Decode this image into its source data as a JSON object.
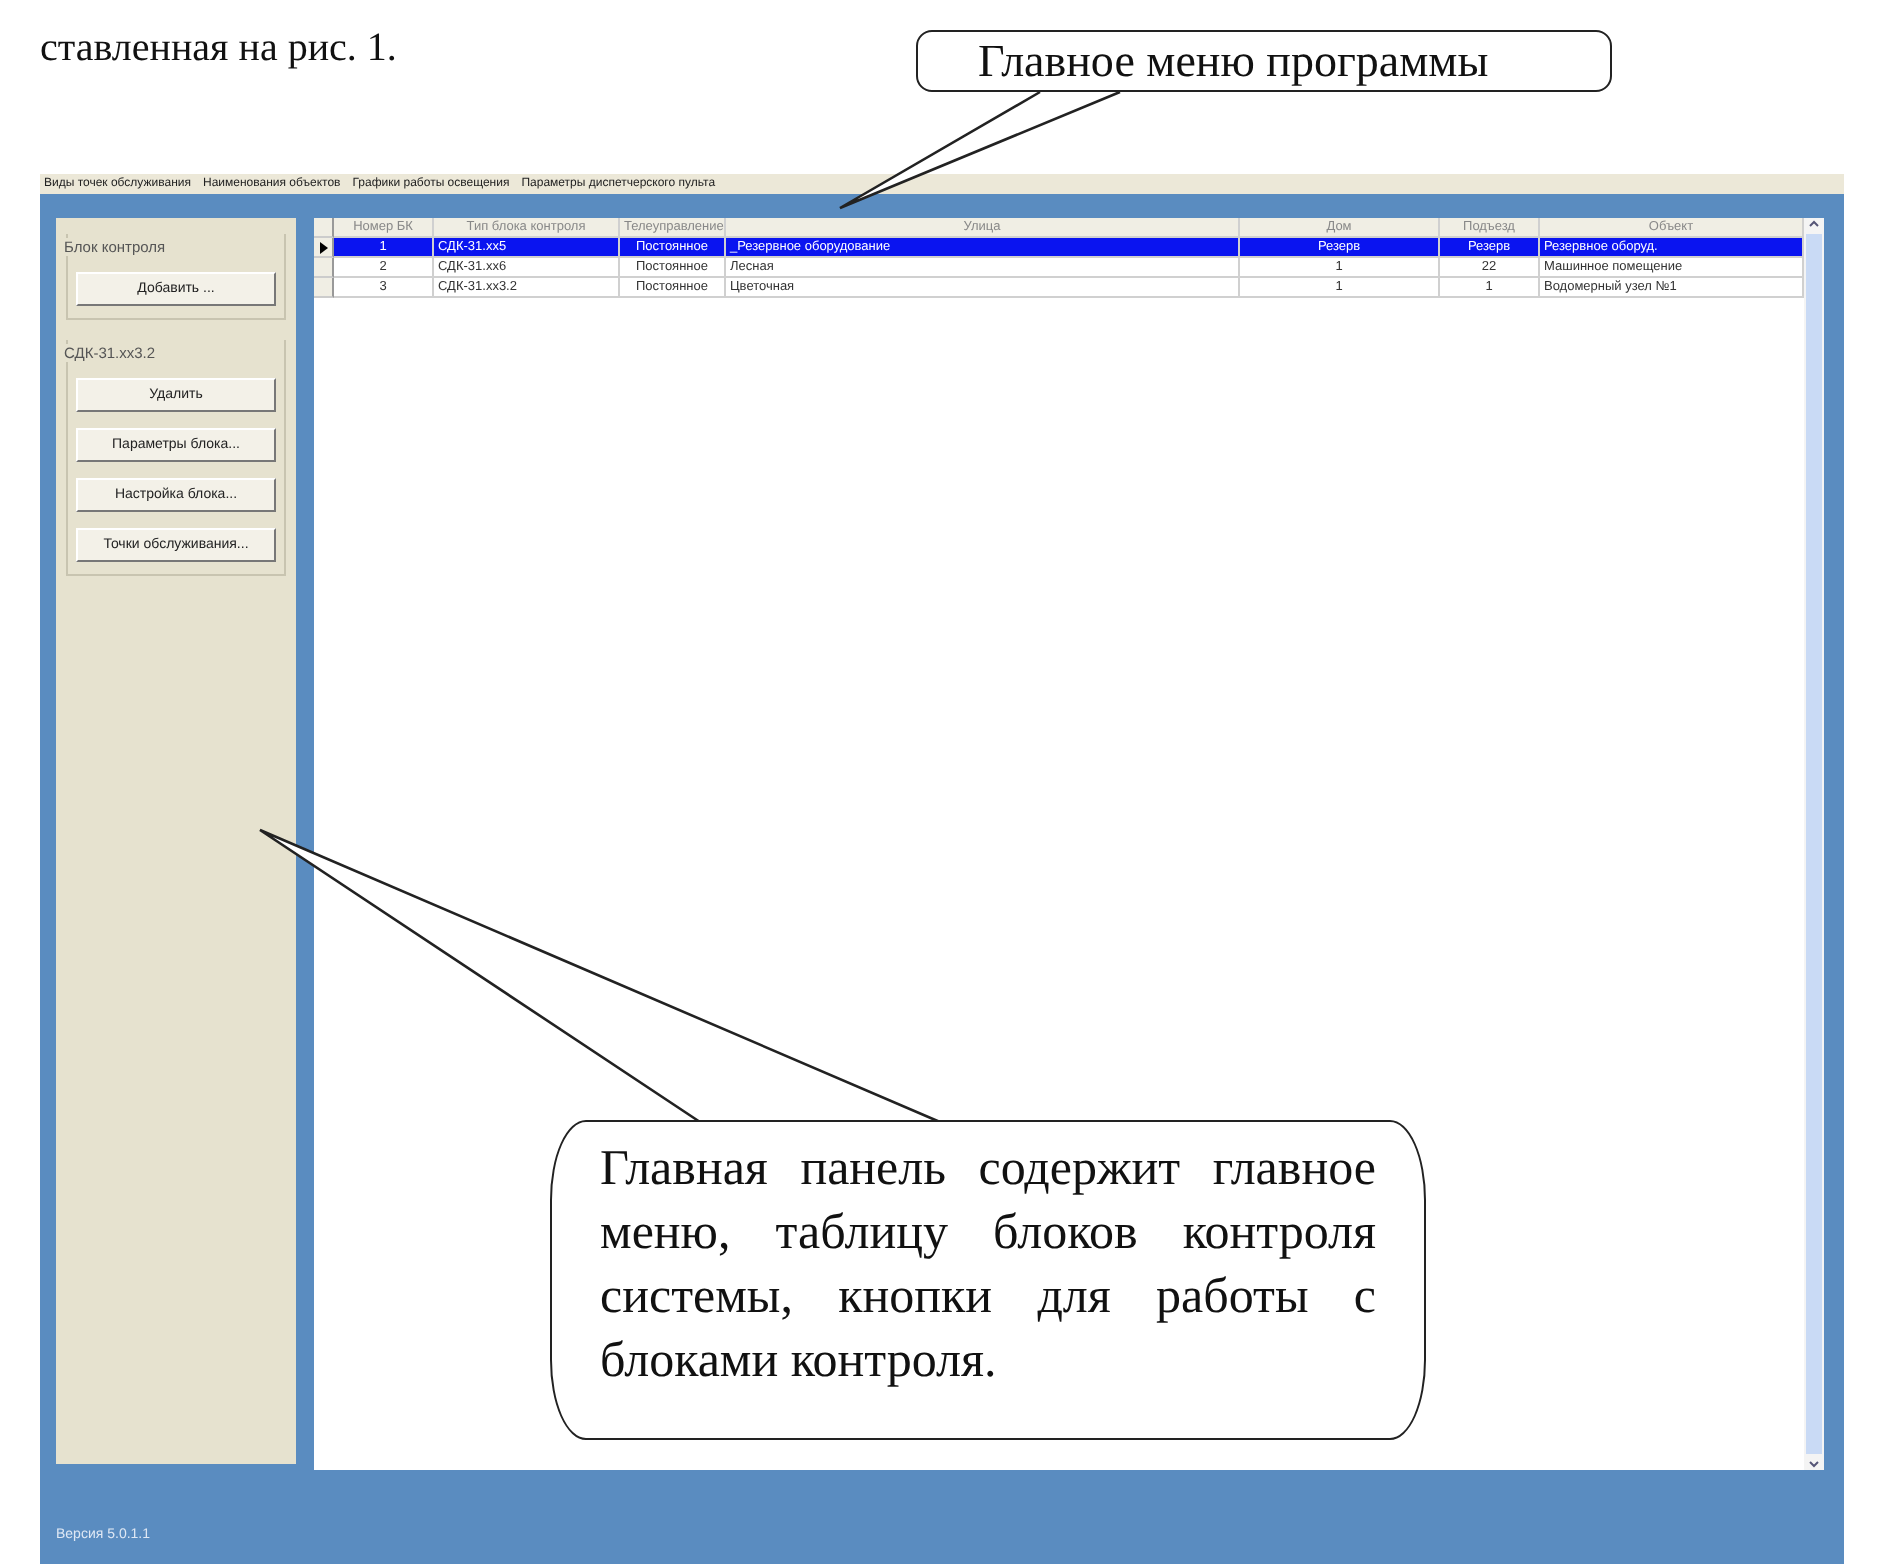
{
  "caption": "ставленная на рис. 1.",
  "callouts": [
    {
      "kind": "menu",
      "text": "Главное меню программы"
    },
    {
      "kind": "panel",
      "text": "Главная панель содержит главное меню, таблицу блоков контроля системы, кнопки для работы с блоками контроля."
    }
  ],
  "menu": [
    "Виды точек обслуживания",
    "Наименования объектов",
    "Графики работы освещения",
    "Параметры диспетчерского пульта"
  ],
  "sidebar": {
    "groups": [
      {
        "title": "Блок контроля",
        "buttons": [
          "Добавить ..."
        ]
      },
      {
        "title": "СДК-31.хх3.2",
        "buttons": [
          "Удалить",
          "Параметры блока...",
          "Настройка блока...",
          "Точки обслуживания..."
        ]
      }
    ]
  },
  "table": {
    "columns": [
      "Номер БК",
      "Тип блока контроля",
      "Телеуправление",
      "Улица",
      "Дом",
      "Подъезд",
      "Объект"
    ],
    "rows": [
      {
        "selected": true,
        "cells": [
          "1",
          "СДК-31.хх5",
          "Постоянное",
          "_Резервное оборудование",
          "Резерв",
          "Резерв",
          "Резервное оборуд."
        ]
      },
      {
        "selected": false,
        "cells": [
          "2",
          "СДК-31.хх6",
          "Постоянное",
          "Лесная",
          "1",
          "22",
          "Машинное помещение"
        ]
      },
      {
        "selected": false,
        "cells": [
          "3",
          "СДК-31.хх3.2",
          "Постоянное",
          "Цветочная",
          "1",
          "1",
          "Водомерный узел №1"
        ]
      }
    ]
  },
  "status": "Версия 5.0.1.1"
}
